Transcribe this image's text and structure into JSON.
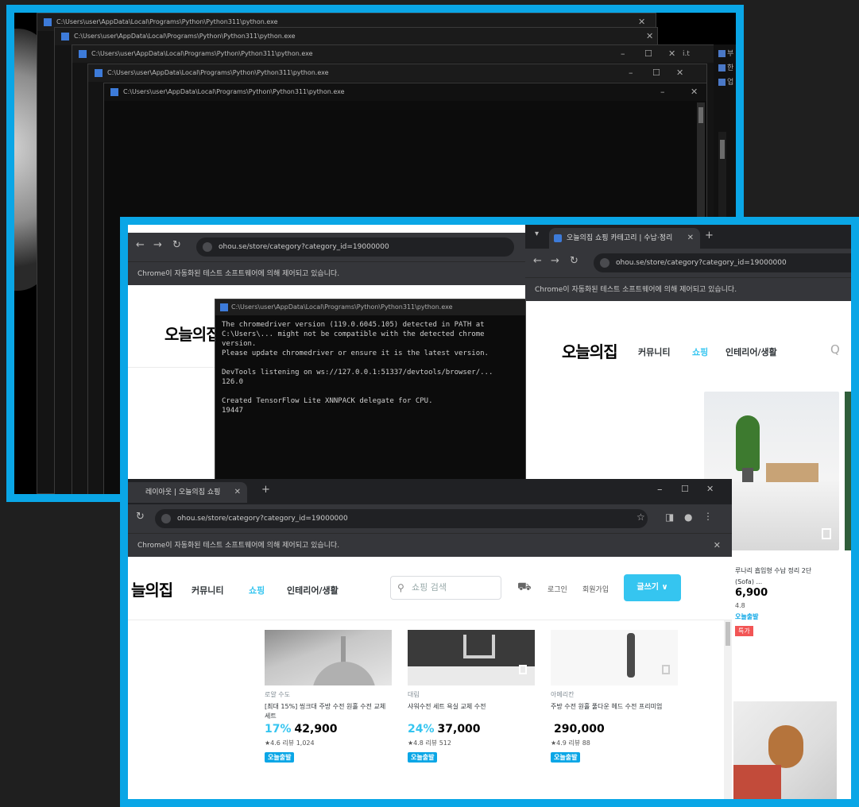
{
  "consoles": [
    {
      "title": "C:\\Users\\user\\AppData\\Local\\Programs\\Python\\Python311\\python.exe"
    },
    {
      "title": "C:\\Users\\user\\AppData\\Local\\Programs\\Python\\Python311\\python.exe"
    },
    {
      "title": "C:\\Users\\user\\AppData\\Local\\Programs\\Python\\Python311\\python.exe"
    },
    {
      "title": "C:\\Users\\user\\AppData\\Local\\Programs\\Python\\Python311\\python.exe"
    },
    {
      "title": "C:\\Users\\user\\AppData\\Local\\Programs\\Python\\Python311\\python.exe"
    }
  ],
  "window_controls": {
    "minimize": "–",
    "maximize": "☐",
    "close": "✕"
  },
  "side_panel": {
    "items": [
      "부",
      "한",
      "업"
    ],
    "top_label": "i.t"
  },
  "browser_back": {
    "url": "ohou.se/store/category?category_id=19000000",
    "infobar": "Chrome이 자동화된 테스트 소프트웨어에 의해 제어되고 있습니다.",
    "logo": "오늘의집"
  },
  "browser_right": {
    "tab_title": "오늘의집 쇼핑 카테고리 | 수납·정리",
    "url": "ohou.se/store/category?category_id=19000000",
    "infobar": "Chrome이 자동화된 테스트 소프트웨어에 의해 제어되고 있습니다.",
    "logo": "오늘의집",
    "nav": [
      "커뮤니티",
      "쇼핑",
      "인테리어/생활"
    ],
    "search_icon": "Q",
    "side_product": {
      "name": "루나리 흡입형 수납 정리 2단",
      "sub": "(Sofa) ...",
      "price": "6,900",
      "rating": "4.8",
      "tag": "특가",
      "badge": "오늘출발"
    }
  },
  "terminal": {
    "title": "C:\\Users\\user\\AppData\\Local\\Programs\\Python\\Python311\\python.exe",
    "lines": "The chromedriver version (119.0.6045.105) detected in PATH at\nC:\\Users\\... might not be compatible with the detected chrome version.\nPlease update chromedriver or ensure it is the latest version.\n\nDevTools listening on ws://127.0.0.1:51337/devtools/browser/...\n126.0\n\nCreated TensorFlow Lite XNNPACK delegate for CPU.\n19447"
  },
  "browser_front": {
    "tab_title": "레이아웃 | 오늘의집 쇼핑",
    "url": "ohou.se/store/category?category_id=19000000",
    "infobar": "Chrome이 자동화된 테스트 소프트웨어에 의해 제어되고 있습니다.",
    "logo": "늘의집",
    "nav": [
      "커뮤니티",
      "쇼핑",
      "인테리어/생활"
    ],
    "search_placeholder": "쇼핑 검색",
    "login": "로그인",
    "signup": "회원가입",
    "write_button": "글쓰기 ∨",
    "products": [
      {
        "brand": "로얄 수도",
        "name": "[최대 15%] 씽크대 주방 수전 원홀 수전 교체 세트",
        "discount": "17%",
        "price": "42,900",
        "rating": "★4.6 리뷰 1,024",
        "badge": "오늘출발"
      },
      {
        "brand": "대림",
        "name": "샤워수전 세트 욕실 교체 수전",
        "discount": "24%",
        "price": "37,000",
        "rating": "★4.8 리뷰 512",
        "badge": "오늘출발"
      },
      {
        "brand": "아메리칸",
        "name": "주방 수전 원홀 풀다운 헤드 수전 프리미엄",
        "discount": "",
        "price": "290,000",
        "rating": "★4.9 리뷰 88",
        "badge": "오늘출발"
      }
    ]
  }
}
